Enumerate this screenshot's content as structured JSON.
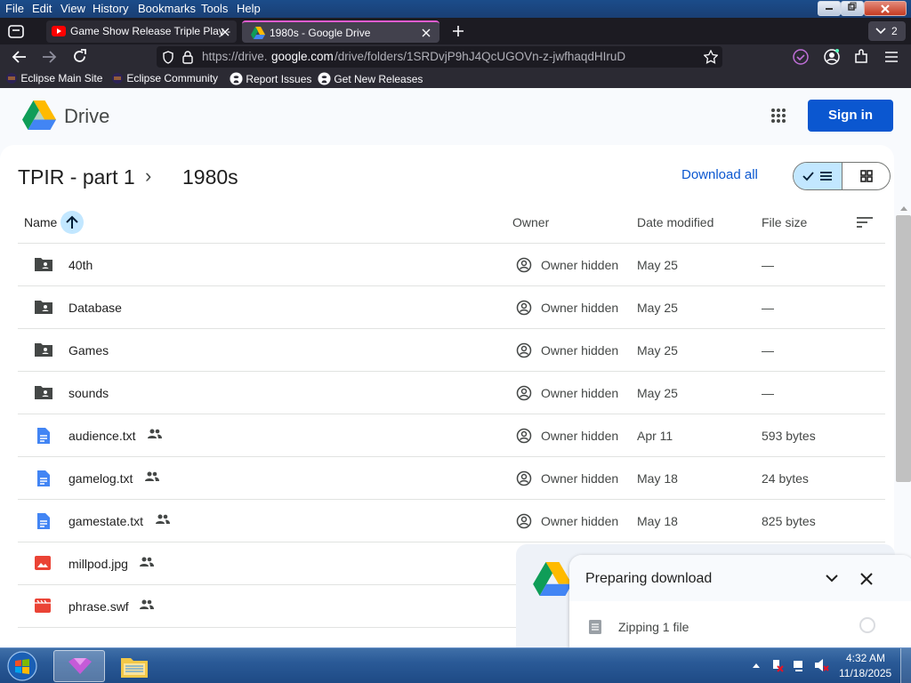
{
  "menubar": {
    "items": [
      "File",
      "Edit",
      "View",
      "History",
      "Bookmarks",
      "Tools",
      "Help"
    ]
  },
  "tabs": {
    "items": [
      {
        "label": "Game Show Release Triple Play -"
      },
      {
        "label": "1980s - Google Drive"
      }
    ],
    "count": "2"
  },
  "nav": {
    "url_prefix": "https://drive.",
    "url_domain": "google.com",
    "url_rest": "/drive/folders/1SRDvjP9hJ4QcUGOVn-z-jwfhaqdHIruD"
  },
  "bookmarks": {
    "items": [
      "Eclipse Main Site",
      "Eclipse Community",
      "Report Issues",
      "Get New Releases"
    ]
  },
  "drive": {
    "logo_text": "Drive",
    "sign_in": "Sign in"
  },
  "breadcrumb": {
    "parent": "TPIR - part 1",
    "current": "1980s",
    "chevron": "›"
  },
  "toolbar": {
    "download_all": "Download all"
  },
  "columns": {
    "name": "Name",
    "owner": "Owner",
    "date": "Date modified",
    "size": "File size"
  },
  "rows": [
    {
      "name": "40th",
      "owner": "Owner hidden",
      "date": "May 25",
      "size": "—",
      "icon": "folder-icon"
    },
    {
      "name": "Database",
      "owner": "Owner hidden",
      "date": "May 25",
      "size": "—",
      "icon": "folder-icon"
    },
    {
      "name": "Games",
      "owner": "Owner hidden",
      "date": "May 25",
      "size": "—",
      "icon": "folder-icon"
    },
    {
      "name": "sounds",
      "owner": "Owner hidden",
      "date": "May 25",
      "size": "—",
      "icon": "folder-icon"
    },
    {
      "name": "audience.txt",
      "owner": "Owner hidden",
      "date": "Apr 11",
      "size": "593 bytes",
      "icon": "doc-icon",
      "shared": true
    },
    {
      "name": "gamelog.txt",
      "owner": "Owner hidden",
      "date": "May 18",
      "size": "24 bytes",
      "icon": "doc-icon",
      "shared": true
    },
    {
      "name": "gamestate.txt",
      "owner": "Owner hidden",
      "date": "May 18",
      "size": "825 bytes",
      "icon": "doc-icon",
      "shared": true
    },
    {
      "name": "millpod.jpg",
      "owner": "",
      "date": "",
      "size": "",
      "icon": "image-icon",
      "shared": true
    },
    {
      "name": "phrase.swf",
      "owner": "",
      "date": "",
      "size": "",
      "icon": "video-icon",
      "shared": true
    }
  ],
  "download_panel": {
    "title": "Preparing download",
    "item": "Zipping 1 file"
  },
  "taskbar": {
    "time": "4:32 AM",
    "date": "11/18/2025"
  },
  "colors": {
    "accent": "#0b57d0",
    "signin_bg": "#0b57d0",
    "page_bg": "#f8fafd"
  }
}
